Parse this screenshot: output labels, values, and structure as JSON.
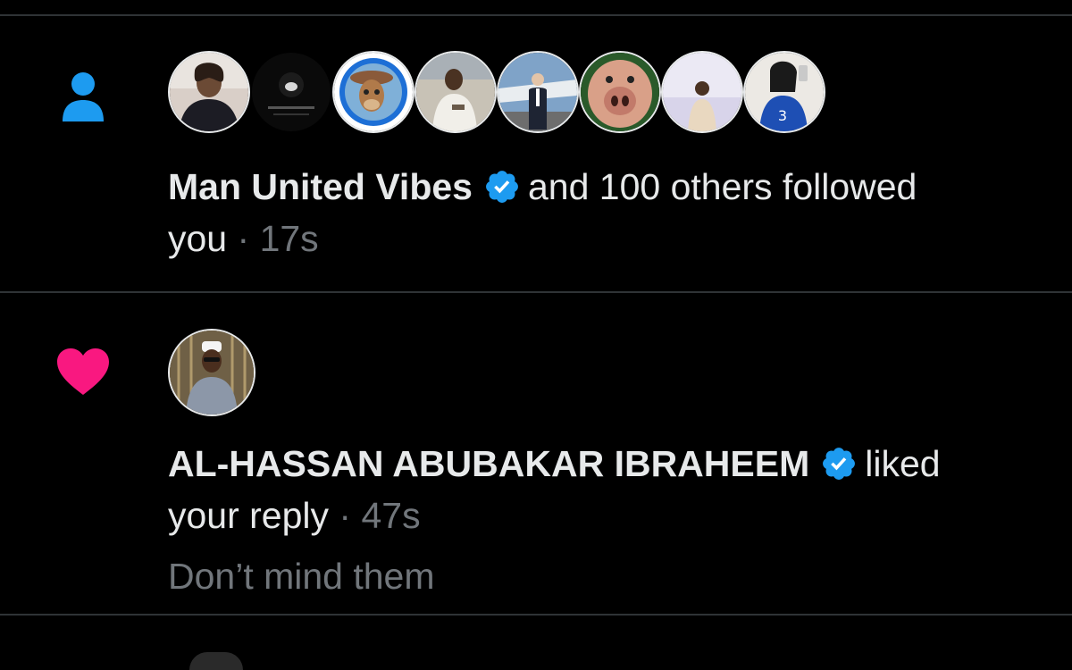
{
  "colors": {
    "background": "#000000",
    "divider": "#2f3336",
    "primary_text": "#e7e9ea",
    "secondary_text": "#71767b",
    "follow_icon": "#1d9bf0",
    "like_icon": "#f91880",
    "verified_badge": "#1d9bf0"
  },
  "notifications": [
    {
      "type": "follow",
      "icon": "person-icon",
      "avatar_count": 8,
      "actor_name": "Man United Vibes",
      "verified": true,
      "action_text": "and 100 others followed",
      "action_text_2": "you",
      "separator": "·",
      "time": "17s"
    },
    {
      "type": "like",
      "icon": "heart-icon",
      "avatar_count": 1,
      "actor_name": "AL-HASSAN ABUBAKAR IBRAHEEM",
      "verified": true,
      "action_text": "liked",
      "action_text_2": "your reply",
      "separator": "·",
      "time": "47s",
      "snippet": "Don’t mind them"
    }
  ]
}
